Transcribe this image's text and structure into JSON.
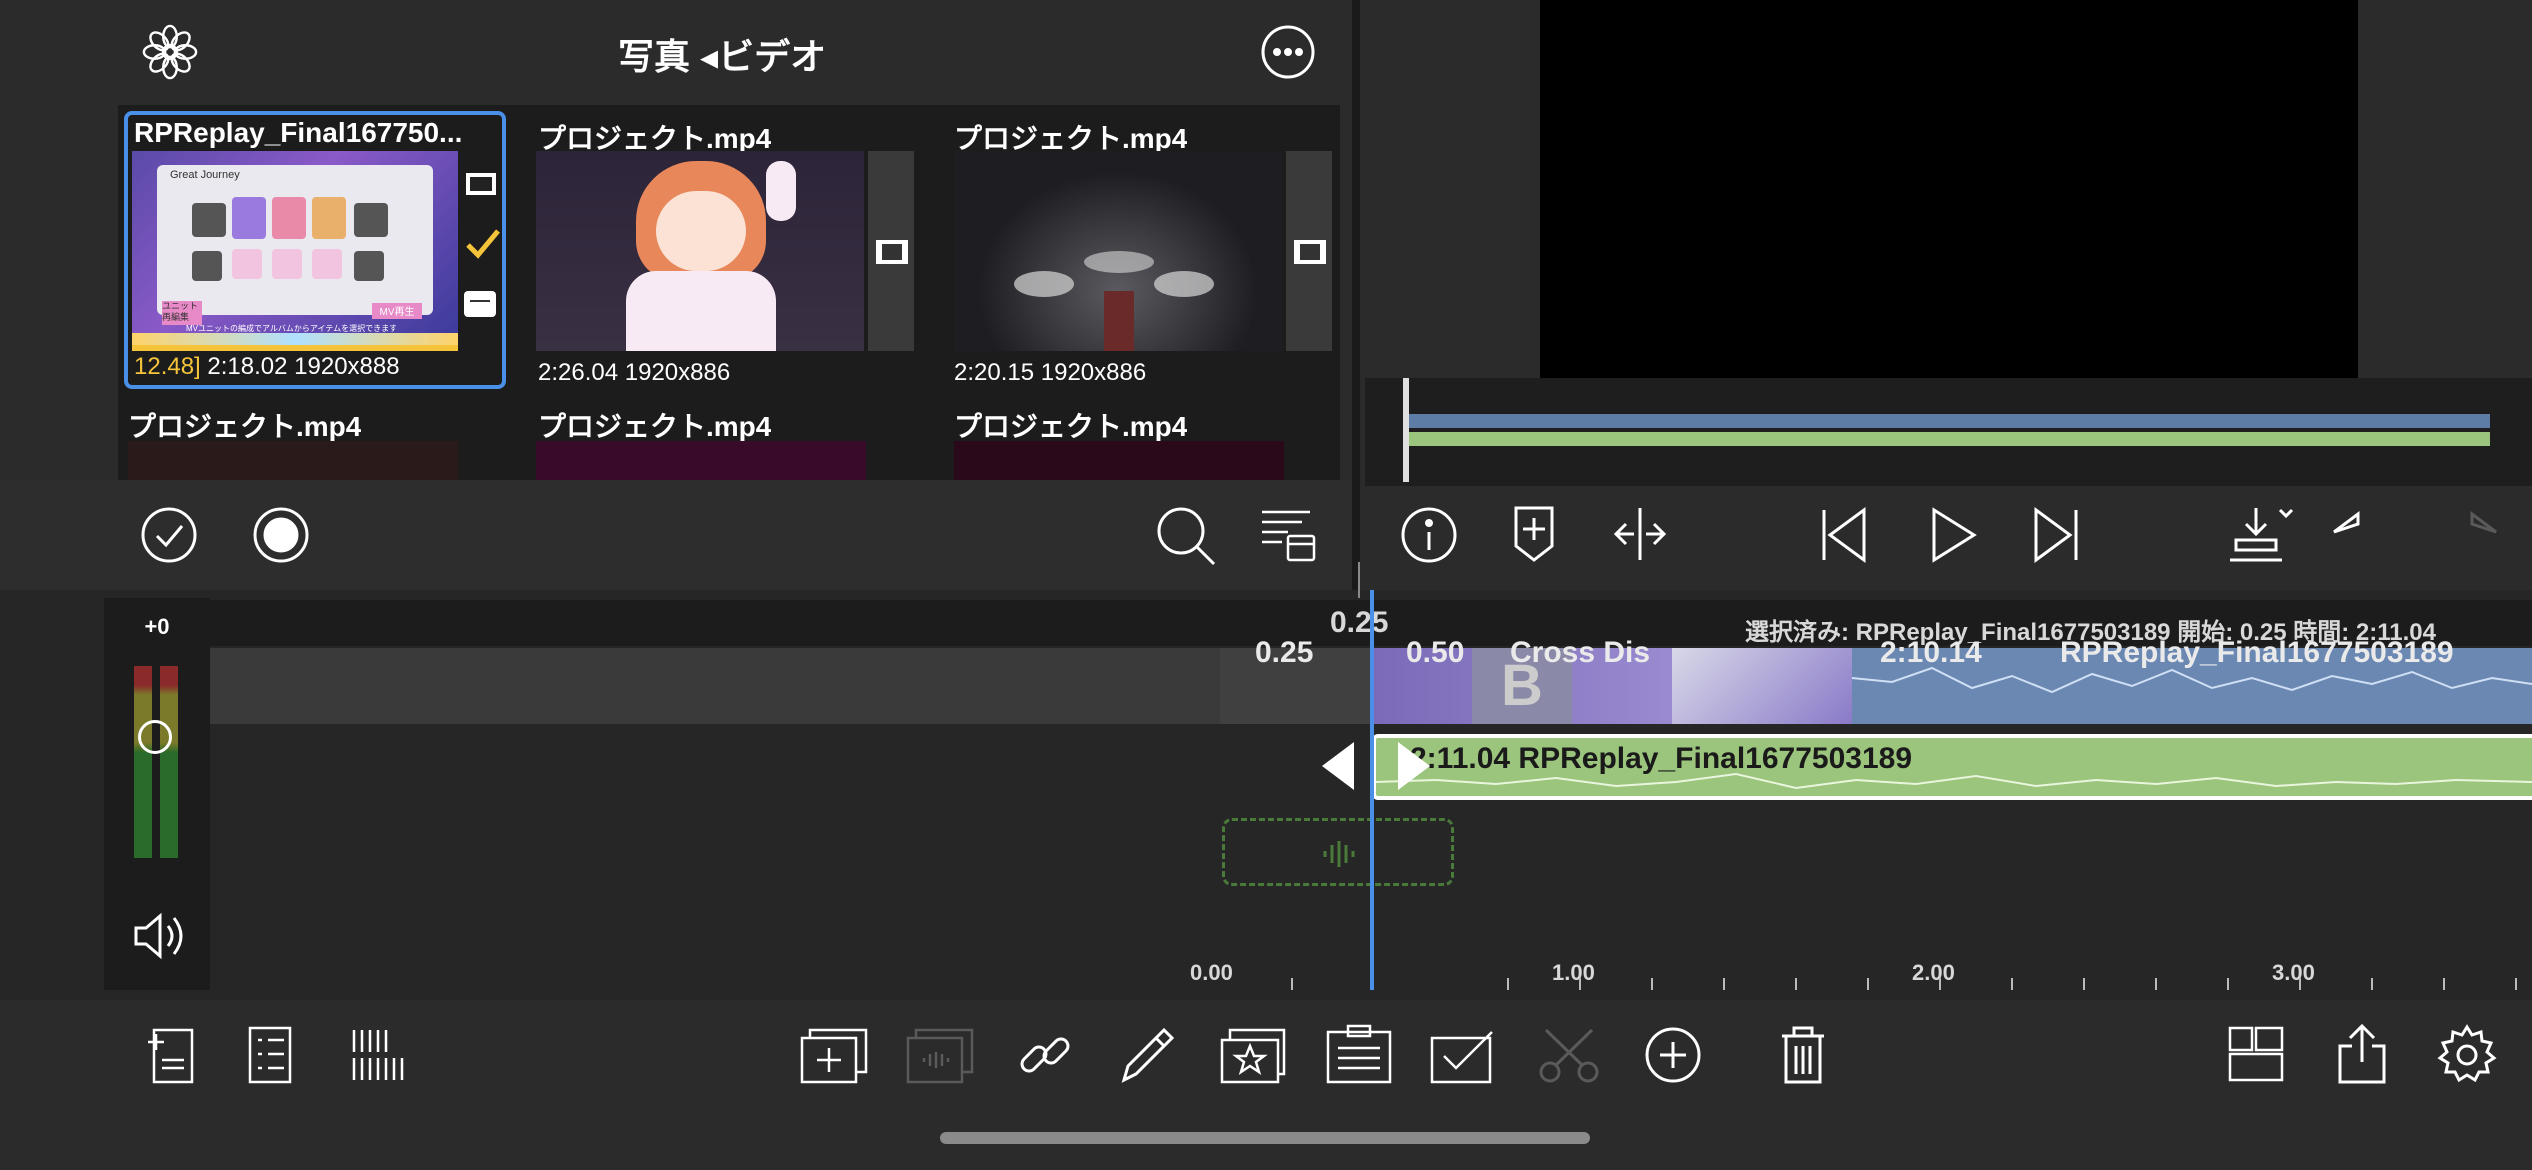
{
  "browser": {
    "title": "写真 ◂ビデオ",
    "items": [
      {
        "label": "RPReplay_Final167750...",
        "duration": "2:18.02",
        "resolution": "1920x888",
        "marker": "12.48]",
        "selected": true
      },
      {
        "label": "プロジェクト.mp4",
        "duration": "2:26.04",
        "resolution": "1920x886"
      },
      {
        "label": "プロジェクト.mp4",
        "duration": "2:20.15",
        "resolution": "1920x886"
      },
      {
        "label": "プロジェクト.mp4"
      },
      {
        "label": "プロジェクト.mp4"
      },
      {
        "label": "プロジェクト.mp4"
      }
    ],
    "thumb_text": {
      "top_banner": "Great Journey",
      "unit_button": "ユニット\n再編集",
      "mv_button": "MV再生",
      "notice": "MVユニットの編成でアルバムからアイテムを選択できます"
    }
  },
  "timeline": {
    "db_offset": "+0",
    "playhead": "0.25",
    "selection_info": "選択済み: RPReplay_Final1677503189 開始: 0.25 時間: 2:11.04",
    "video_track_labels": [
      "0.25",
      "0.50",
      "Cross Dis",
      "2:10.14",
      "RPReplay_Final1677503189"
    ],
    "audio_clip_label": "2:11.04 RPReplay_Final1677503189",
    "ruler": [
      "0.00",
      "1.00",
      "2.00",
      "3.00"
    ]
  },
  "colors": {
    "accent_blue": "#4a8fe8",
    "video_clip": "#6b88b3",
    "audio_clip": "#9bc47c",
    "highlight_yellow": "#f5c43a"
  }
}
